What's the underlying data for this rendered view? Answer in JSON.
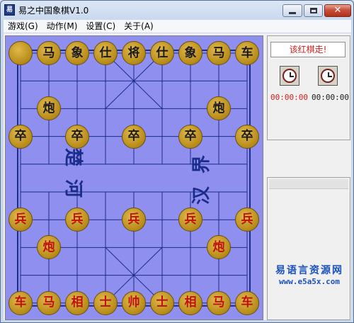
{
  "window": {
    "title": "易之中国象棋V1.0",
    "app_icon_text": "易"
  },
  "menu": [
    {
      "label": "游戏(G)"
    },
    {
      "label": "动作(M)"
    },
    {
      "label": "设置(C)"
    },
    {
      "label": "关于(A)"
    }
  ],
  "board": {
    "river_left": "楚河",
    "river_right": "汉界",
    "rows": [
      [
        "",
        "马",
        "象",
        "仕",
        "将",
        "仕",
        "象",
        "马",
        "车"
      ],
      [
        "",
        "",
        "",
        "",
        "",
        "",
        "",
        "",
        ""
      ],
      [
        "",
        "炮",
        "",
        "",
        "",
        "",
        "",
        "炮",
        ""
      ],
      [
        "卒",
        "",
        "卒",
        "",
        "卒",
        "",
        "卒",
        "",
        "卒"
      ],
      [
        "",
        "",
        "",
        "",
        "",
        "",
        "",
        "",
        ""
      ],
      [
        "",
        "",
        "",
        "",
        "",
        "",
        "",
        "",
        ""
      ],
      [
        "兵",
        "",
        "兵",
        "",
        "兵",
        "",
        "兵",
        "",
        "兵"
      ],
      [
        "",
        "炮",
        "",
        "",
        "",
        "",
        "",
        "炮",
        ""
      ],
      [
        "",
        "",
        "",
        "",
        "",
        "",
        "",
        "",
        ""
      ],
      [
        "车",
        "马",
        "相",
        "士",
        "帅",
        "士",
        "相",
        "马",
        "车"
      ]
    ],
    "row_colors": [
      "black",
      "black",
      "black",
      "black",
      "none",
      "none",
      "red",
      "red",
      "red",
      "red"
    ],
    "colors": {
      "board_bg": "#8f8ff0",
      "line": "#1c2c8a",
      "piece": "#b58a18",
      "red_text": "#c01010"
    }
  },
  "status": {
    "turn_text": "该红棋走!",
    "red_time": "00:00:00",
    "black_time": "00:00:00",
    "red_clock_icon": "clock-icon",
    "black_clock_icon": "clock-icon"
  },
  "watermark": {
    "line1": "易语言资源网",
    "line2": "www.e5a5x.com"
  }
}
